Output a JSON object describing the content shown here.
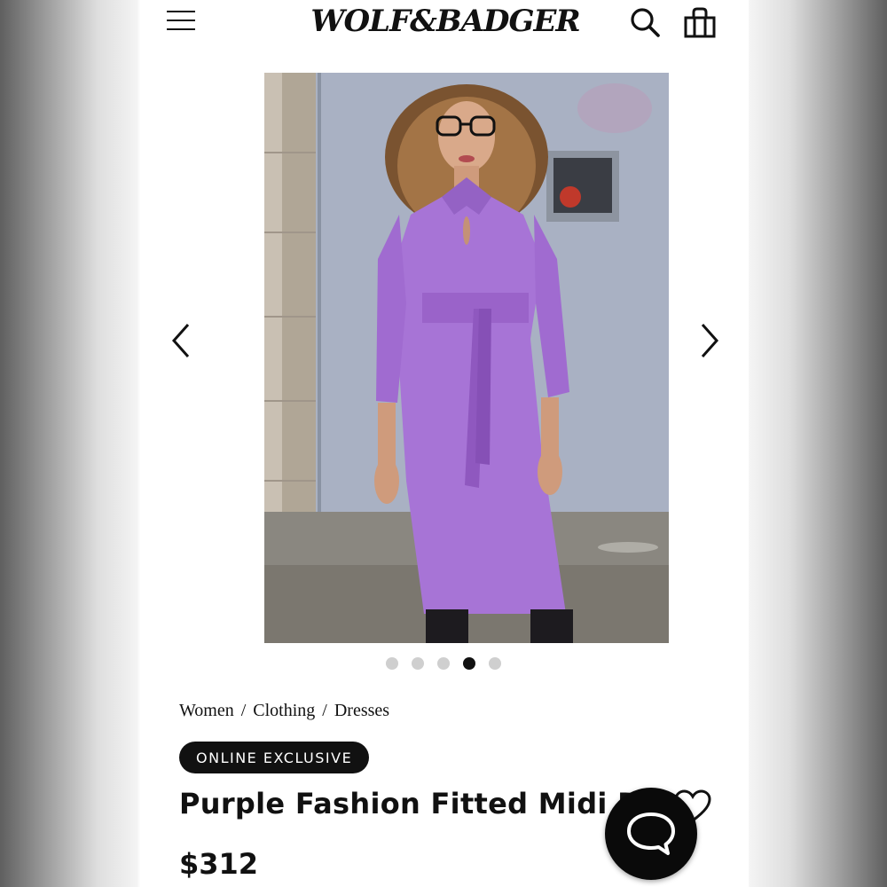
{
  "header": {
    "logo_text": "WOLF&BADGER",
    "menu_icon": "hamburger-menu-icon",
    "search_icon": "search-icon",
    "bag_icon": "shopping-bag-icon"
  },
  "gallery": {
    "image_subject": "model wearing purple fitted midi dress",
    "dress_color": "#a774d6",
    "prev_icon": "chevron-left-icon",
    "next_icon": "chevron-right-icon",
    "total_images": 5,
    "active_index": 4
  },
  "breadcrumb": {
    "items": [
      "Women",
      "Clothing",
      "Dresses"
    ],
    "separator": "/"
  },
  "product": {
    "badge": "ONLINE EXCLUSIVE",
    "title": "Purple Fashion Fitted Midi Dre",
    "price": "$312",
    "wishlist_icon": "heart-icon"
  },
  "chat": {
    "icon": "chat-bubble-icon"
  }
}
